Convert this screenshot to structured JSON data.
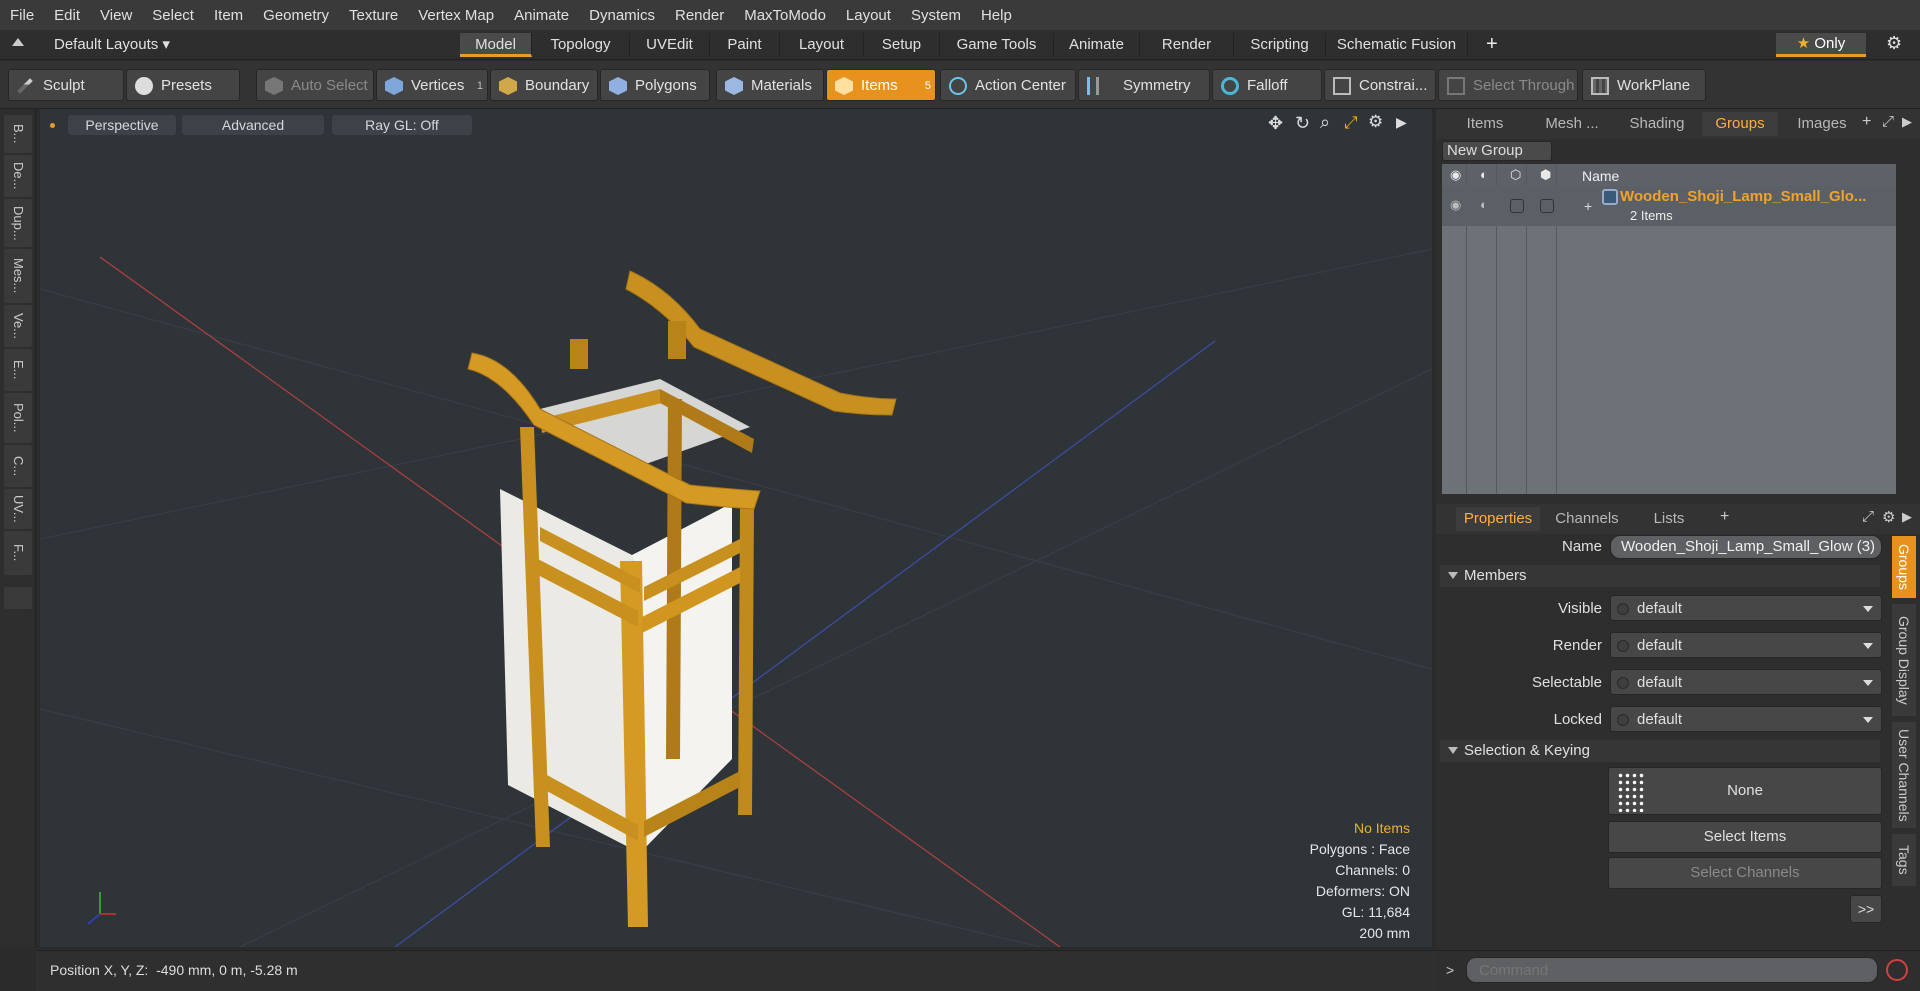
{
  "menu": [
    "File",
    "Edit",
    "View",
    "Select",
    "Item",
    "Geometry",
    "Texture",
    "Vertex Map",
    "Animate",
    "Dynamics",
    "Render",
    "MaxToModo",
    "Layout",
    "System",
    "Help"
  ],
  "layout_selector": "Default Layouts",
  "workspace_tabs": [
    "Model",
    "Topology",
    "UVEdit",
    "Paint",
    "Layout",
    "Setup",
    "Game Tools",
    "Animate",
    "Render",
    "Scripting",
    "Schematic Fusion"
  ],
  "active_tab": "Model",
  "only_label": "Only",
  "toolbar": {
    "sculpt": "Sculpt",
    "presets": "Presets",
    "auto_select": "Auto Select",
    "vertices": "Vertices",
    "vertices_count": "1",
    "boundary": "Boundary",
    "polygons": "Polygons",
    "materials": "Materials",
    "items": "Items",
    "items_count": "5",
    "action_center": "Action Center",
    "symmetry": "Symmetry",
    "falloff": "Falloff",
    "constraints": "Constrai...",
    "select_through": "Select Through",
    "workplane": "WorkPlane"
  },
  "left_tabs": [
    "B...",
    "De...",
    "Dup...",
    "Mes...",
    "Ve...",
    "E...",
    "Pol...",
    "C...",
    "UV...",
    "F..."
  ],
  "viewport": {
    "perspective": "Perspective",
    "advanced": "Advanced",
    "raygl": "Ray GL: Off",
    "stats": {
      "items": "No Items",
      "polygons": "Polygons : Face",
      "channels": "Channels: 0",
      "deformers": "Deformers: ON",
      "gl": "GL: 11,684",
      "scale": "200 mm"
    }
  },
  "status": {
    "position": "Position X, Y, Z:  -490 mm, 0 m, -5.28 m"
  },
  "right_panel": {
    "tabs": [
      "Items",
      "Mesh ...",
      "Shading",
      "Groups",
      "Images"
    ],
    "active_tab": "Groups",
    "new_group": "New Group",
    "col_name": "Name",
    "group_name": "Wooden_Shoji_Lamp_Small_Glo...",
    "group_count": "2 Items",
    "prop_tabs": [
      "Properties",
      "Channels",
      "Lists"
    ],
    "name_label": "Name",
    "name_value": "Wooden_Shoji_Lamp_Small_Glow (3)",
    "members": "Members",
    "rows": [
      {
        "label": "Visible",
        "value": "default"
      },
      {
        "label": "Render",
        "value": "default"
      },
      {
        "label": "Selectable",
        "value": "default"
      },
      {
        "label": "Locked",
        "value": "default"
      }
    ],
    "selection_keying": "Selection & Keying",
    "none": "None",
    "select_items": "Select Items",
    "select_channels": "Select Channels",
    "more": ">>",
    "side_tabs": [
      "Groups",
      "Group Display",
      "User Channels",
      "Tags"
    ],
    "command_placeholder": "Command"
  },
  "colors": {
    "accent": "#e8921e",
    "viewport": "#2f3439",
    "wood": "#c8901e"
  }
}
